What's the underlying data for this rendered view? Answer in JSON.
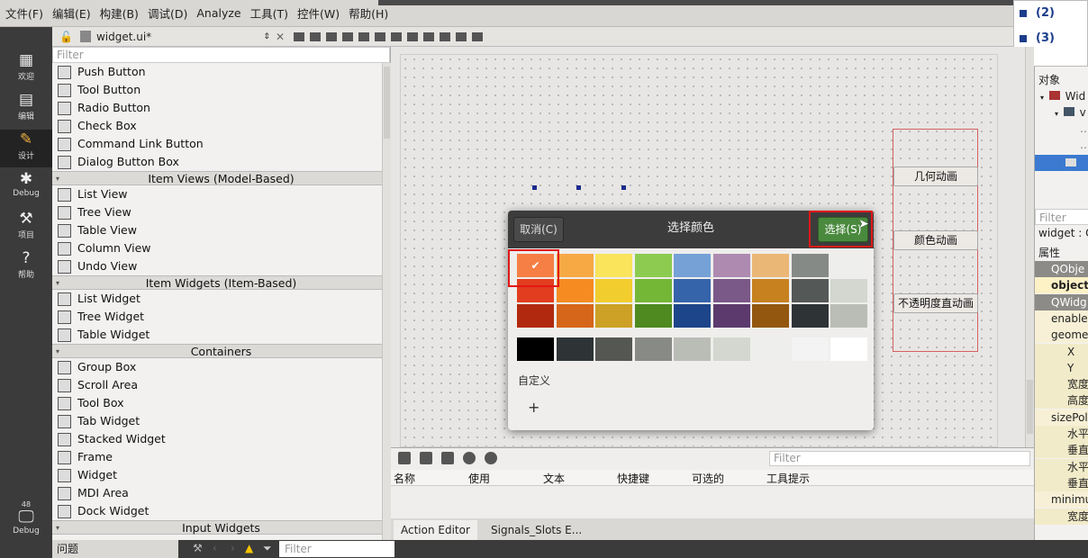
{
  "menu": [
    "文件(F)",
    "编辑(E)",
    "构建(B)",
    "调试(D)",
    "Analyze",
    "工具(T)",
    "控件(W)",
    "帮助(H)"
  ],
  "doc_tab": {
    "filename": "widget.ui*"
  },
  "doc_popup": {
    "items": [
      "(2)",
      "(3)"
    ]
  },
  "modes": [
    {
      "label": "欢迎",
      "icon": "grid-icon"
    },
    {
      "label": "编辑",
      "icon": "edit-icon"
    },
    {
      "label": "设计",
      "icon": "pencil-icon",
      "active": true
    },
    {
      "label": "Debug",
      "icon": "bug-icon"
    },
    {
      "label": "项目",
      "icon": "wrench-icon"
    },
    {
      "label": "帮助",
      "icon": "help-icon"
    }
  ],
  "kit": {
    "number": "48",
    "label": "Debug"
  },
  "widget_box": {
    "filter_placeholder": "Filter",
    "groups": [
      {
        "category": "",
        "items": [
          "Push Button",
          "Tool Button",
          "Radio Button",
          "Check Box",
          "Command Link Button",
          "Dialog Button Box"
        ]
      },
      {
        "category": "Item Views (Model-Based)",
        "items": [
          "List View",
          "Tree View",
          "Table View",
          "Column View",
          "Undo View"
        ]
      },
      {
        "category": "Item Widgets (Item-Based)",
        "items": [
          "List Widget",
          "Tree Widget",
          "Table Widget"
        ]
      },
      {
        "category": "Containers",
        "items": [
          "Group Box",
          "Scroll Area",
          "Tool Box",
          "Tab Widget",
          "Stacked Widget",
          "Frame",
          "Widget",
          "MDI Area",
          "Dock Widget"
        ]
      },
      {
        "category": "Input Widgets",
        "items": []
      }
    ]
  },
  "form": {
    "buttons": [
      "几何动画",
      "颜色动画",
      "不透明度直动画"
    ]
  },
  "color_dialog": {
    "title": "选择颜色",
    "cancel": "取消(C)",
    "select": "选择(S)",
    "selected_mark": "✔",
    "custom_label": "自定义",
    "add": "+",
    "palette_columns": [
      [
        "#f57f45",
        "#e33d1f",
        "#b12a0f"
      ],
      [
        "#f7a944",
        "#f58b21",
        "#d6661a"
      ],
      [
        "#f9e45c",
        "#f2cd2e",
        "#cda126"
      ],
      [
        "#8ccb4f",
        "#74b736",
        "#4e8a1f"
      ],
      [
        "#75a1d6",
        "#3564ab",
        "#1d4589"
      ],
      [
        "#ae8ab1",
        "#7a5888",
        "#5d3a6d"
      ],
      [
        "#ebb776",
        "#c7811f",
        "#93570f"
      ],
      [
        "#868a87",
        "#545856",
        "#2e3436"
      ],
      [
        "#eeeeec",
        "#d3d7cf",
        "#babdb6"
      ]
    ],
    "grays": [
      "#000000",
      "#2e3436",
      "#555753",
      "#888a85",
      "#babdb6",
      "#d3d7cf",
      "#eeeeec",
      "#f3f3f3",
      "#ffffff"
    ]
  },
  "action_editor": {
    "filter_placeholder": "Filter",
    "columns": [
      "名称",
      "使用",
      "文本",
      "快捷键",
      "可选的",
      "工具提示"
    ],
    "tabs": [
      "Action Editor",
      "Signals_Slots E..."
    ]
  },
  "right_panel": {
    "object_header": "对象",
    "tree": [
      "Wid",
      "v"
    ],
    "filter_placeholder": "Filter",
    "widget_line": "widget : Q",
    "props_header": "属性",
    "props": [
      {
        "text": "QObje",
        "type": "section"
      },
      {
        "text": "object",
        "type": "bold"
      },
      {
        "text": "QWidg",
        "type": "section"
      },
      {
        "text": "enabled",
        "type": "plain"
      },
      {
        "text": "geome",
        "type": "group"
      },
      {
        "text": "X",
        "type": "sub"
      },
      {
        "text": "Y",
        "type": "sub"
      },
      {
        "text": "宽度",
        "type": "sub"
      },
      {
        "text": "高度",
        "type": "sub"
      },
      {
        "text": "sizePol",
        "type": "group"
      },
      {
        "text": "水平",
        "type": "sub"
      },
      {
        "text": "垂直",
        "type": "sub"
      },
      {
        "text": "水平",
        "type": "sub"
      },
      {
        "text": "垂直",
        "type": "sub"
      },
      {
        "text": "minimu",
        "type": "group"
      },
      {
        "text": "宽度",
        "type": "sub"
      }
    ]
  },
  "status": {
    "issues": "问题",
    "filter_placeholder": "Filter"
  }
}
